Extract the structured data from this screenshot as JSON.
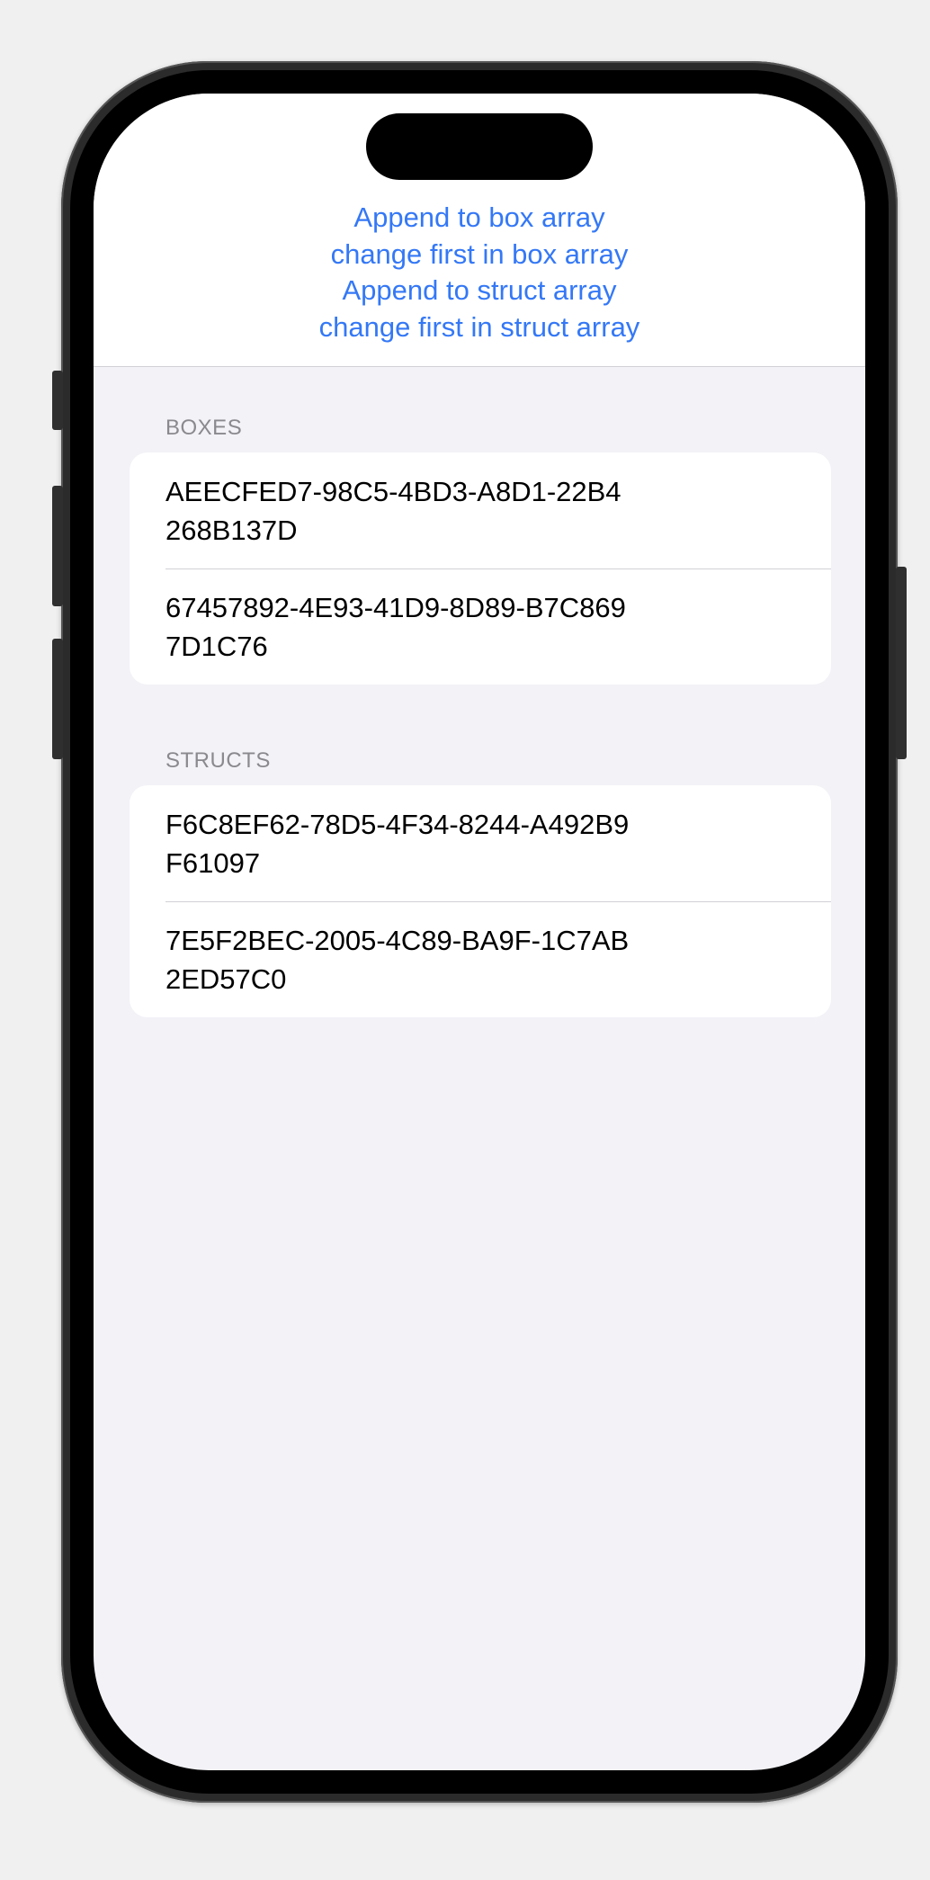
{
  "toolbar": {
    "buttons": [
      "Append to box array",
      "change first in box array",
      "Append to struct array",
      "change first in struct array"
    ]
  },
  "sections": {
    "boxes": {
      "header": "BOXES",
      "rows": [
        "AEECFED7-98C5-4BD3-A8D1-22B4268B137D",
        "67457892-4E93-41D9-8D89-B7C8697D1C76"
      ]
    },
    "structs": {
      "header": "STRUCTS",
      "rows": [
        "F6C8EF62-78D5-4F34-8244-A492B9F61097",
        "7E5F2BEC-2005-4C89-BA9F-1C7AB2ED57C0"
      ]
    }
  },
  "colors": {
    "accent": "#3478f6",
    "grouped_background": "#f2f2f7",
    "secondary_label": "#8a8a8e"
  }
}
